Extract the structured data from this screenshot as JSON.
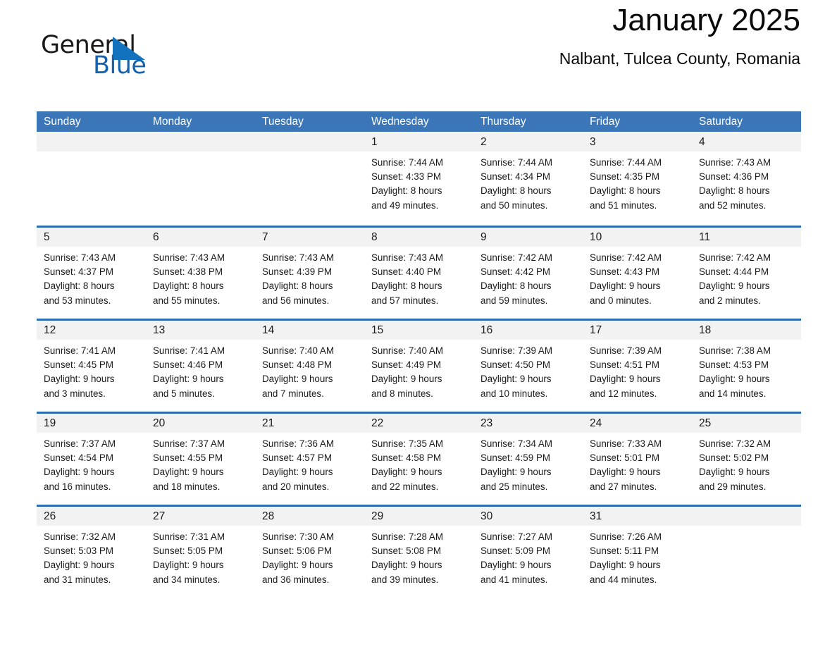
{
  "brand": {
    "word_one": "General",
    "word_two": "Blue",
    "triangle_color": "#1272bd",
    "blue_text_color": "#1263ad"
  },
  "header": {
    "month_title": "January 2025",
    "location": "Nalbant, Tulcea County, Romania"
  },
  "theme": {
    "header_blue": "#3b76b8",
    "rule_blue": "#2e6daf",
    "day_band_gray": "#f2f2f2"
  },
  "weekdays": [
    "Sunday",
    "Monday",
    "Tuesday",
    "Wednesday",
    "Thursday",
    "Friday",
    "Saturday"
  ],
  "weeks": [
    [
      {
        "day": "",
        "sunrise": "",
        "sunset": "",
        "daylight_line1": "",
        "daylight_line2": ""
      },
      {
        "day": "",
        "sunrise": "",
        "sunset": "",
        "daylight_line1": "",
        "daylight_line2": ""
      },
      {
        "day": "",
        "sunrise": "",
        "sunset": "",
        "daylight_line1": "",
        "daylight_line2": ""
      },
      {
        "day": "1",
        "sunrise": "Sunrise: 7:44 AM",
        "sunset": "Sunset: 4:33 PM",
        "daylight_line1": "Daylight: 8 hours",
        "daylight_line2": "and 49 minutes."
      },
      {
        "day": "2",
        "sunrise": "Sunrise: 7:44 AM",
        "sunset": "Sunset: 4:34 PM",
        "daylight_line1": "Daylight: 8 hours",
        "daylight_line2": "and 50 minutes."
      },
      {
        "day": "3",
        "sunrise": "Sunrise: 7:44 AM",
        "sunset": "Sunset: 4:35 PM",
        "daylight_line1": "Daylight: 8 hours",
        "daylight_line2": "and 51 minutes."
      },
      {
        "day": "4",
        "sunrise": "Sunrise: 7:43 AM",
        "sunset": "Sunset: 4:36 PM",
        "daylight_line1": "Daylight: 8 hours",
        "daylight_line2": "and 52 minutes."
      }
    ],
    [
      {
        "day": "5",
        "sunrise": "Sunrise: 7:43 AM",
        "sunset": "Sunset: 4:37 PM",
        "daylight_line1": "Daylight: 8 hours",
        "daylight_line2": "and 53 minutes."
      },
      {
        "day": "6",
        "sunrise": "Sunrise: 7:43 AM",
        "sunset": "Sunset: 4:38 PM",
        "daylight_line1": "Daylight: 8 hours",
        "daylight_line2": "and 55 minutes."
      },
      {
        "day": "7",
        "sunrise": "Sunrise: 7:43 AM",
        "sunset": "Sunset: 4:39 PM",
        "daylight_line1": "Daylight: 8 hours",
        "daylight_line2": "and 56 minutes."
      },
      {
        "day": "8",
        "sunrise": "Sunrise: 7:43 AM",
        "sunset": "Sunset: 4:40 PM",
        "daylight_line1": "Daylight: 8 hours",
        "daylight_line2": "and 57 minutes."
      },
      {
        "day": "9",
        "sunrise": "Sunrise: 7:42 AM",
        "sunset": "Sunset: 4:42 PM",
        "daylight_line1": "Daylight: 8 hours",
        "daylight_line2": "and 59 minutes."
      },
      {
        "day": "10",
        "sunrise": "Sunrise: 7:42 AM",
        "sunset": "Sunset: 4:43 PM",
        "daylight_line1": "Daylight: 9 hours",
        "daylight_line2": "and 0 minutes."
      },
      {
        "day": "11",
        "sunrise": "Sunrise: 7:42 AM",
        "sunset": "Sunset: 4:44 PM",
        "daylight_line1": "Daylight: 9 hours",
        "daylight_line2": "and 2 minutes."
      }
    ],
    [
      {
        "day": "12",
        "sunrise": "Sunrise: 7:41 AM",
        "sunset": "Sunset: 4:45 PM",
        "daylight_line1": "Daylight: 9 hours",
        "daylight_line2": "and 3 minutes."
      },
      {
        "day": "13",
        "sunrise": "Sunrise: 7:41 AM",
        "sunset": "Sunset: 4:46 PM",
        "daylight_line1": "Daylight: 9 hours",
        "daylight_line2": "and 5 minutes."
      },
      {
        "day": "14",
        "sunrise": "Sunrise: 7:40 AM",
        "sunset": "Sunset: 4:48 PM",
        "daylight_line1": "Daylight: 9 hours",
        "daylight_line2": "and 7 minutes."
      },
      {
        "day": "15",
        "sunrise": "Sunrise: 7:40 AM",
        "sunset": "Sunset: 4:49 PM",
        "daylight_line1": "Daylight: 9 hours",
        "daylight_line2": "and 8 minutes."
      },
      {
        "day": "16",
        "sunrise": "Sunrise: 7:39 AM",
        "sunset": "Sunset: 4:50 PM",
        "daylight_line1": "Daylight: 9 hours",
        "daylight_line2": "and 10 minutes."
      },
      {
        "day": "17",
        "sunrise": "Sunrise: 7:39 AM",
        "sunset": "Sunset: 4:51 PM",
        "daylight_line1": "Daylight: 9 hours",
        "daylight_line2": "and 12 minutes."
      },
      {
        "day": "18",
        "sunrise": "Sunrise: 7:38 AM",
        "sunset": "Sunset: 4:53 PM",
        "daylight_line1": "Daylight: 9 hours",
        "daylight_line2": "and 14 minutes."
      }
    ],
    [
      {
        "day": "19",
        "sunrise": "Sunrise: 7:37 AM",
        "sunset": "Sunset: 4:54 PM",
        "daylight_line1": "Daylight: 9 hours",
        "daylight_line2": "and 16 minutes."
      },
      {
        "day": "20",
        "sunrise": "Sunrise: 7:37 AM",
        "sunset": "Sunset: 4:55 PM",
        "daylight_line1": "Daylight: 9 hours",
        "daylight_line2": "and 18 minutes."
      },
      {
        "day": "21",
        "sunrise": "Sunrise: 7:36 AM",
        "sunset": "Sunset: 4:57 PM",
        "daylight_line1": "Daylight: 9 hours",
        "daylight_line2": "and 20 minutes."
      },
      {
        "day": "22",
        "sunrise": "Sunrise: 7:35 AM",
        "sunset": "Sunset: 4:58 PM",
        "daylight_line1": "Daylight: 9 hours",
        "daylight_line2": "and 22 minutes."
      },
      {
        "day": "23",
        "sunrise": "Sunrise: 7:34 AM",
        "sunset": "Sunset: 4:59 PM",
        "daylight_line1": "Daylight: 9 hours",
        "daylight_line2": "and 25 minutes."
      },
      {
        "day": "24",
        "sunrise": "Sunrise: 7:33 AM",
        "sunset": "Sunset: 5:01 PM",
        "daylight_line1": "Daylight: 9 hours",
        "daylight_line2": "and 27 minutes."
      },
      {
        "day": "25",
        "sunrise": "Sunrise: 7:32 AM",
        "sunset": "Sunset: 5:02 PM",
        "daylight_line1": "Daylight: 9 hours",
        "daylight_line2": "and 29 minutes."
      }
    ],
    [
      {
        "day": "26",
        "sunrise": "Sunrise: 7:32 AM",
        "sunset": "Sunset: 5:03 PM",
        "daylight_line1": "Daylight: 9 hours",
        "daylight_line2": "and 31 minutes."
      },
      {
        "day": "27",
        "sunrise": "Sunrise: 7:31 AM",
        "sunset": "Sunset: 5:05 PM",
        "daylight_line1": "Daylight: 9 hours",
        "daylight_line2": "and 34 minutes."
      },
      {
        "day": "28",
        "sunrise": "Sunrise: 7:30 AM",
        "sunset": "Sunset: 5:06 PM",
        "daylight_line1": "Daylight: 9 hours",
        "daylight_line2": "and 36 minutes."
      },
      {
        "day": "29",
        "sunrise": "Sunrise: 7:28 AM",
        "sunset": "Sunset: 5:08 PM",
        "daylight_line1": "Daylight: 9 hours",
        "daylight_line2": "and 39 minutes."
      },
      {
        "day": "30",
        "sunrise": "Sunrise: 7:27 AM",
        "sunset": "Sunset: 5:09 PM",
        "daylight_line1": "Daylight: 9 hours",
        "daylight_line2": "and 41 minutes."
      },
      {
        "day": "31",
        "sunrise": "Sunrise: 7:26 AM",
        "sunset": "Sunset: 5:11 PM",
        "daylight_line1": "Daylight: 9 hours",
        "daylight_line2": "and 44 minutes."
      },
      {
        "day": "",
        "sunrise": "",
        "sunset": "",
        "daylight_line1": "",
        "daylight_line2": ""
      }
    ]
  ]
}
